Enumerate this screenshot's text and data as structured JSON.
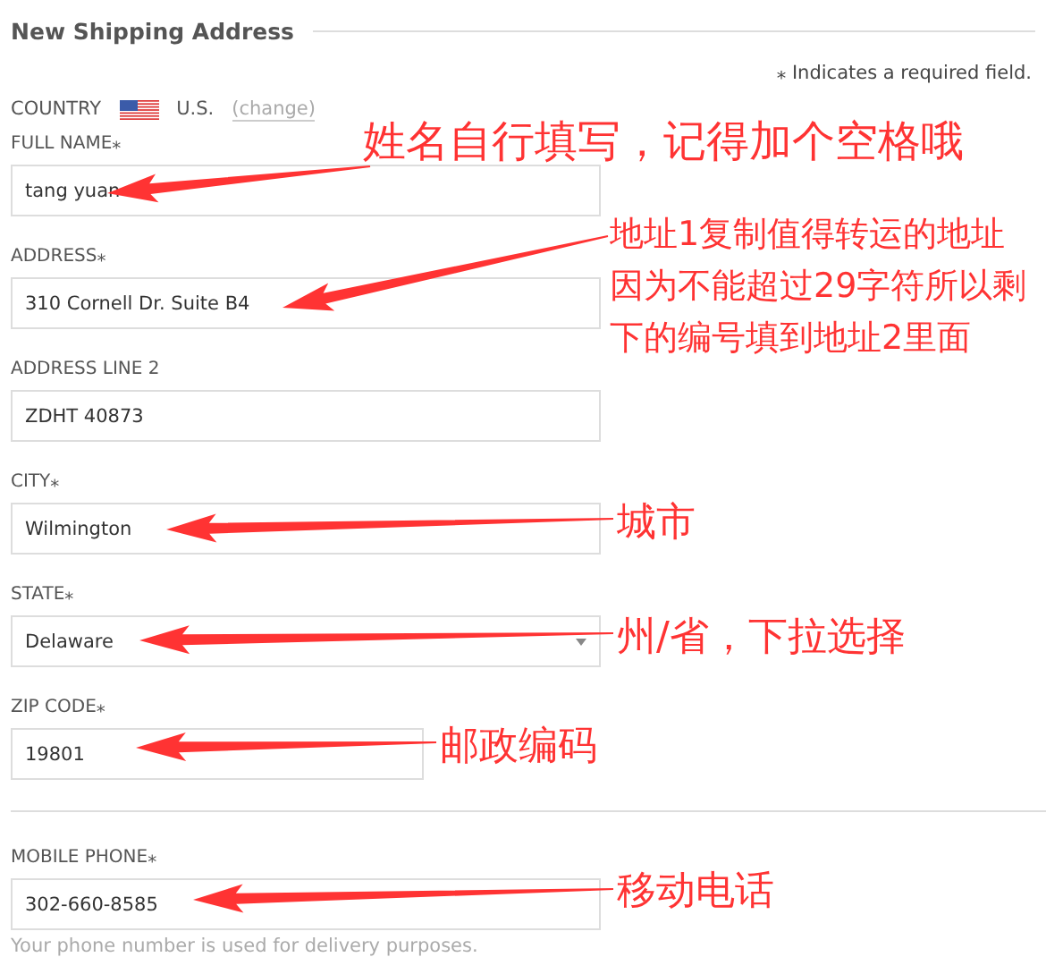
{
  "header": {
    "title": "New Shipping Address"
  },
  "required_note": "⁎ Indicates a required field.",
  "required_mark": "⁎",
  "country": {
    "label": "COUNTRY",
    "value": "U.S.",
    "change_link": "(change)"
  },
  "sections": [
    {
      "fields": [
        {
          "kind": "text",
          "label": "FULL NAME",
          "required": true,
          "value": "tang yuan",
          "annotation": [
            "姓名自行填写，记得加个空格哦"
          ]
        },
        {
          "kind": "text",
          "label": "ADDRESS",
          "required": true,
          "value": "310 Cornell Dr. Suite B4",
          "annotation": [
            "地址1复制值得转运的地址",
            "因为不能超过29字符所以剩",
            "下的编号填到地址2里面"
          ]
        },
        {
          "kind": "text",
          "label": "ADDRESS LINE 2",
          "required": false,
          "value": "ZDHT 40873"
        },
        {
          "kind": "text",
          "label": "CITY",
          "required": true,
          "value": "Wilmington",
          "annotation": [
            "城市"
          ]
        },
        {
          "kind": "select",
          "label": "STATE",
          "required": true,
          "value": "Delaware",
          "annotation": [
            "州/省，下拉选择"
          ]
        },
        {
          "kind": "short",
          "label": "ZIP CODE",
          "required": true,
          "value": "19801",
          "annotation": [
            "邮政编码"
          ]
        }
      ]
    },
    {
      "fields": [
        {
          "kind": "text",
          "label": "MOBILE PHONE",
          "required": true,
          "value": "302-660-8585",
          "helper": "Your phone number is used for delivery purposes.",
          "annotation": [
            "移动电话"
          ]
        }
      ]
    }
  ]
}
